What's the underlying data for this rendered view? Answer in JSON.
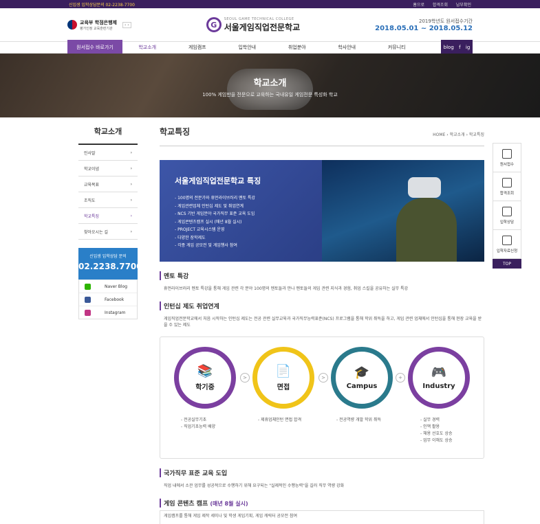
{
  "topbar": {
    "phone": "신입생 입학상담문의 02-2238-7700",
    "links": [
      "홈으로",
      "합격조회",
      "납부확인"
    ]
  },
  "header": {
    "gov_title": "교육부 학점은행제",
    "gov_sub": "평가인정 교육훈련기관",
    "logo_en": "SEOUL GAME TECHNICAL COLLEGE",
    "logo_ko": "서울게임직업전문학교",
    "period_label": "2019학년도 원서접수기간",
    "period_value": "2018.05.01 ~ 2018.05.12"
  },
  "nav": {
    "apply": "원서접수 바로가기",
    "menu": [
      "학교소개",
      "게임캠프",
      "입학안내",
      "취업분야",
      "학사안내",
      "커뮤니티"
    ],
    "active_index": 0,
    "social": [
      "blog",
      "f",
      "ig"
    ]
  },
  "hero": {
    "title": "학교소개",
    "sub": "100% 게임만을 전문으로 교육하는 국내유일 게임전문 특성화 학교"
  },
  "sidebar": {
    "title": "학교소개",
    "items": [
      "인사말",
      "학교이념",
      "교육목표",
      "조직도",
      "학교특징",
      "찾아오시는 길"
    ],
    "active_index": 4,
    "consult_label": "신입생 입학상담 문의",
    "consult_phone": "02.2238.7700",
    "sns": [
      {
        "label": "Naver Blog",
        "color": "#2db400"
      },
      {
        "label": "Facebook",
        "color": "#3b5998"
      },
      {
        "label": "Instagram",
        "color": "#c13584"
      }
    ]
  },
  "page": {
    "title": "학교특징",
    "breadcrumb": [
      "HOME",
      "학교소개",
      "학교특징"
    ]
  },
  "feature": {
    "title": "서울게임직업전문학교 특징",
    "items": [
      "- 100명의 전문가와 휴먼라이브러리 멘토 특강",
      "- 게임관련업체 인턴십 제도 및 취업연계",
      "- NCS 기반 게임분야 국가직무 표준 교육 도입",
      "- 게임콘텐츠캠프 실시 (매년 8월 실시)",
      "- PROJECT 교육시스템 운영",
      "- 다양한 장학제도",
      "- 각종 게임 공모전 및 게임행사 참여"
    ]
  },
  "sections": {
    "mentor_title": "멘토 특강",
    "mentor_desc": "휴먼라이브러리 멘토 특강을 통해 게임 관련 각 분야 100명의 멘토들과 만나 멘토들의 게임 관련 지식과 경험, 취업 스킬을 공유하는 실무 특강",
    "intern_title": "인턴십 제도 취업연계",
    "intern_desc": "게임직업전문학교에서 처음 시작하는 인턴십 제도는 전공 관련 실무교육과 국가직무능력표준(NCS) 프로그램을 통해 학위 취득을 하고, 게임 관련 업체에서 인턴십을 통해 현장 교육을 받을 수 있는 제도",
    "ncs_title": "국가직무 표준 교육 도입",
    "ncs_desc": "직업 내에서 소관 업무를 성공적으로 수행하기 위해 요구되는 \"실제적인 수행능력\"을 길러 직무 역량 강화",
    "camp_title": "게임 콘텐츠 캠프",
    "camp_em": "(매년 8월 실시)",
    "camp_desc": "게임캠프를 통해 게임 제작 세미나 및 학생 게임기획, 게임 캐릭터 공모전 참여"
  },
  "flow": {
    "steps": [
      {
        "label": "학기중",
        "color": "#7b3fa0",
        "icon": "books-icon",
        "bullets": [
          "- 전공실무기초",
          "- 직업기초능력 배양"
        ]
      },
      {
        "label": "면접",
        "color": "#f0c419",
        "icon": "document-icon",
        "bullets": [
          "- 제휴업체인턴 면접 합격"
        ]
      },
      {
        "label": "Campus",
        "color": "#2a7a8c",
        "icon": "graduation-cap-icon",
        "bullets": [
          "- 전공역량 개발 학위 취득"
        ]
      },
      {
        "label": "Industry",
        "color": "#7b3fa0",
        "icon": "gamepad-icon",
        "bullets": [
          "- 실무 경력",
          "- 인맥 활용",
          "- 채용 선호도 상승",
          "- 업무 이해도 상승"
        ]
      }
    ],
    "connectors": [
      ">",
      ">",
      "+"
    ]
  },
  "right_nav": {
    "items": [
      "원서접수",
      "합격조회",
      "입학상담",
      "입학자료신청"
    ],
    "top": "TOP"
  }
}
